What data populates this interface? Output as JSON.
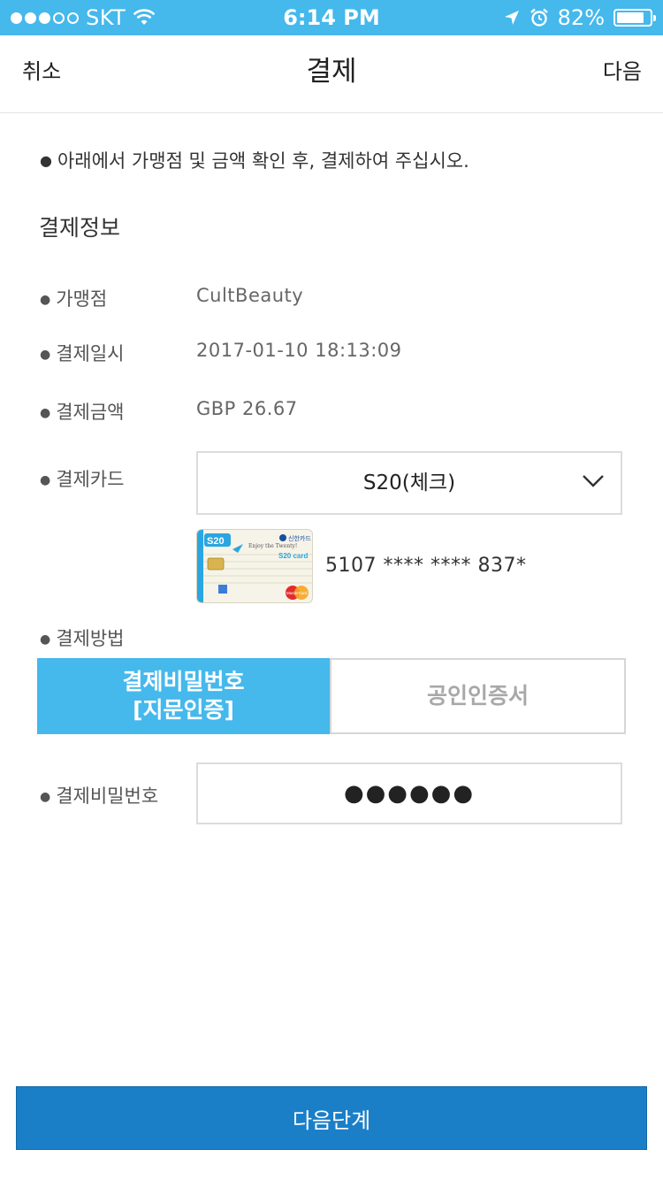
{
  "status_bar": {
    "carrier": "SKT",
    "time": "6:14 PM",
    "battery_pct": "82%",
    "battery_level": 0.82,
    "signal_bars": 3,
    "signal_total": 5
  },
  "nav": {
    "cancel_label": "취소",
    "title": "결제",
    "next_label": "다음"
  },
  "notice": "아래에서 가맹점 및 금액 확인 후, 결제하여 주십시오.",
  "section_title": "결제정보",
  "info": {
    "merchant_label": "가맹점",
    "merchant_value": "CultBeauty",
    "date_label": "결제일시",
    "date_value": "2017-01-10 18:13:09",
    "amount_label": "결제금액",
    "amount_value": "GBP 26.67",
    "card_label": "결제카드",
    "card_selected": "S20(체크)",
    "card_number": "5107 **** **** 837*",
    "method_label": "결제방법",
    "password_label": "결제비밀번호",
    "password_value": "●●●●●●"
  },
  "card_image": {
    "brand_text": "S20",
    "issuer_text": "신한카드",
    "slogan_text": "Enjoy the Twenty!",
    "product_text": "S20 card",
    "network_text": "MasterCard"
  },
  "method_tabs": {
    "active_label": "결제비밀번호\n[지문인증]",
    "inactive_label": "공인인증서"
  },
  "bottom_button": "다음단계",
  "colors": {
    "status_bar": "#45b8ec",
    "tab_active": "#45b8ec",
    "button": "#1b7fc8"
  }
}
